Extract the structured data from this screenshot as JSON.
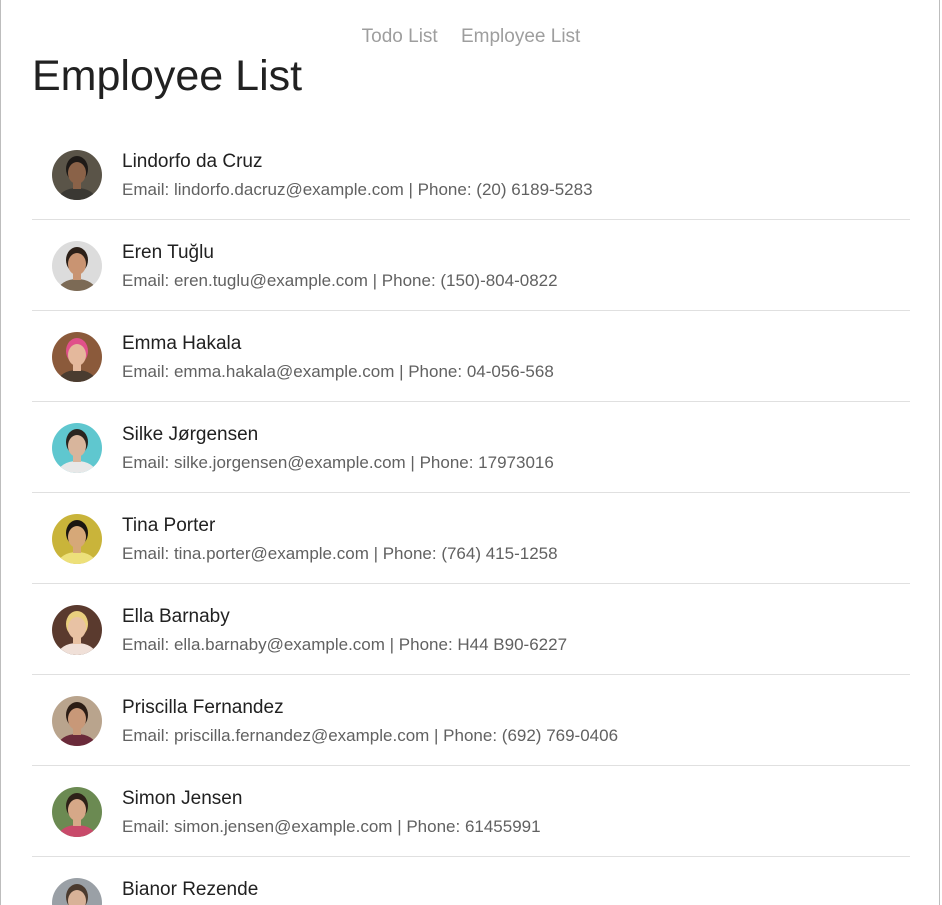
{
  "nav": {
    "links": [
      {
        "label": "Todo List"
      },
      {
        "label": "Employee List"
      }
    ]
  },
  "page": {
    "title": "Employee List"
  },
  "employees": [
    {
      "name": "Lindorfo da Cruz",
      "details": "Email: lindorfo.dacruz@example.com | Phone: (20) 6189-5283",
      "avatar": {
        "bg": "#5a5448",
        "skin": "#8a6248",
        "hair": "#1e1a17",
        "shirt": "#3a3833"
      }
    },
    {
      "name": "Eren Tuğlu",
      "details": "Email: eren.tuglu@example.com | Phone: (150)-804-0822",
      "avatar": {
        "bg": "#dcdcdc",
        "skin": "#c99472",
        "hair": "#2c2018",
        "shirt": "#7c6a55"
      }
    },
    {
      "name": "Emma Hakala",
      "details": "Email: emma.hakala@example.com | Phone: 04-056-568",
      "avatar": {
        "bg": "#8b5a3b",
        "skin": "#e4b89c",
        "hair": "#e0508a",
        "shirt": "#4a3c30"
      }
    },
    {
      "name": "Silke Jørgensen",
      "details": "Email: silke.jorgensen@example.com | Phone: 17973016",
      "avatar": {
        "bg": "#5fc7cf",
        "skin": "#d8b59c",
        "hair": "#2a2520",
        "shirt": "#e8e8e8"
      }
    },
    {
      "name": "Tina Porter",
      "details": "Email: tina.porter@example.com | Phone: (764) 415-1258",
      "avatar": {
        "bg": "#c9b43a",
        "skin": "#d6a878",
        "hair": "#1b1610",
        "shirt": "#ede07a"
      }
    },
    {
      "name": "Ella Barnaby",
      "details": "Email: ella.barnaby@example.com | Phone: H44 B90-6227",
      "avatar": {
        "bg": "#5a3a2e",
        "skin": "#e8c2a4",
        "hair": "#e9cf7e",
        "shirt": "#f0e0d8"
      }
    },
    {
      "name": "Priscilla Fernandez",
      "details": "Email: priscilla.fernandez@example.com | Phone: (692) 769-0406",
      "avatar": {
        "bg": "#b9a48d",
        "skin": "#c89878",
        "hair": "#2b1d15",
        "shirt": "#6a2a3a"
      }
    },
    {
      "name": "Simon Jensen",
      "details": "Email: simon.jensen@example.com | Phone: 61455991",
      "avatar": {
        "bg": "#6b8a52",
        "skin": "#d6a888",
        "hair": "#2e2118",
        "shirt": "#c84a6a"
      }
    },
    {
      "name": "Bianor Rezende",
      "details": "",
      "avatar": {
        "bg": "#9aa0a6",
        "skin": "#d8b298",
        "hair": "#4a3a2e",
        "shirt": "#7d8894"
      }
    }
  ]
}
